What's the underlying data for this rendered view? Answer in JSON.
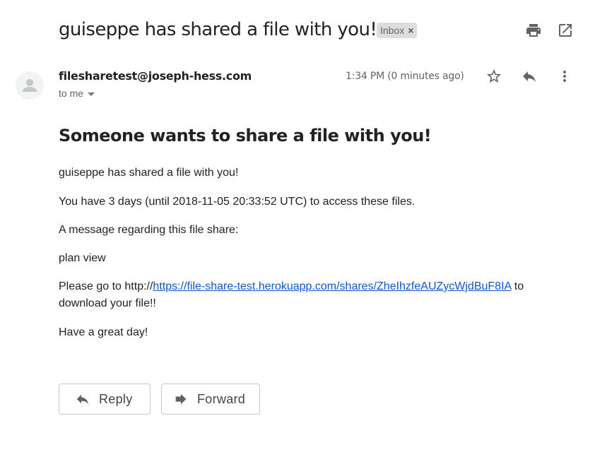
{
  "email": {
    "subject": "guiseppe has shared a file with you!",
    "label": "Inbox",
    "label_remove": "×",
    "sender": "filesharetest@joseph-hess.com",
    "recipient_line": "to me",
    "timestamp": "1:34 PM (0 minutes ago)"
  },
  "body": {
    "heading": "Someone wants to share a file with you!",
    "line1": "guiseppe has shared a file with you!",
    "line2": "You have 3 days (until 2018-11-05 20:33:52 UTC) to access these files.",
    "line3": "A message regarding this file share:",
    "line4": "plan view",
    "link_prefix": "Please go to http://",
    "link_text": "https://file-share-test.herokuapp.com/shares/ZheIhzfeAUZycWjdBuF8IA",
    "link_suffix": " to",
    "link_line2": "download your file!!",
    "closing": "Have a great day!"
  },
  "actions": {
    "reply": "Reply",
    "forward": "Forward"
  },
  "icons": [
    "print-icon",
    "open-in-new-window-icon",
    "star-icon",
    "reply-icon",
    "more-vertical-icon",
    "default-avatar-icon"
  ],
  "colors": {
    "link": "#1155cc",
    "label_chip": "#dddddd",
    "icon": "#5f6368"
  }
}
